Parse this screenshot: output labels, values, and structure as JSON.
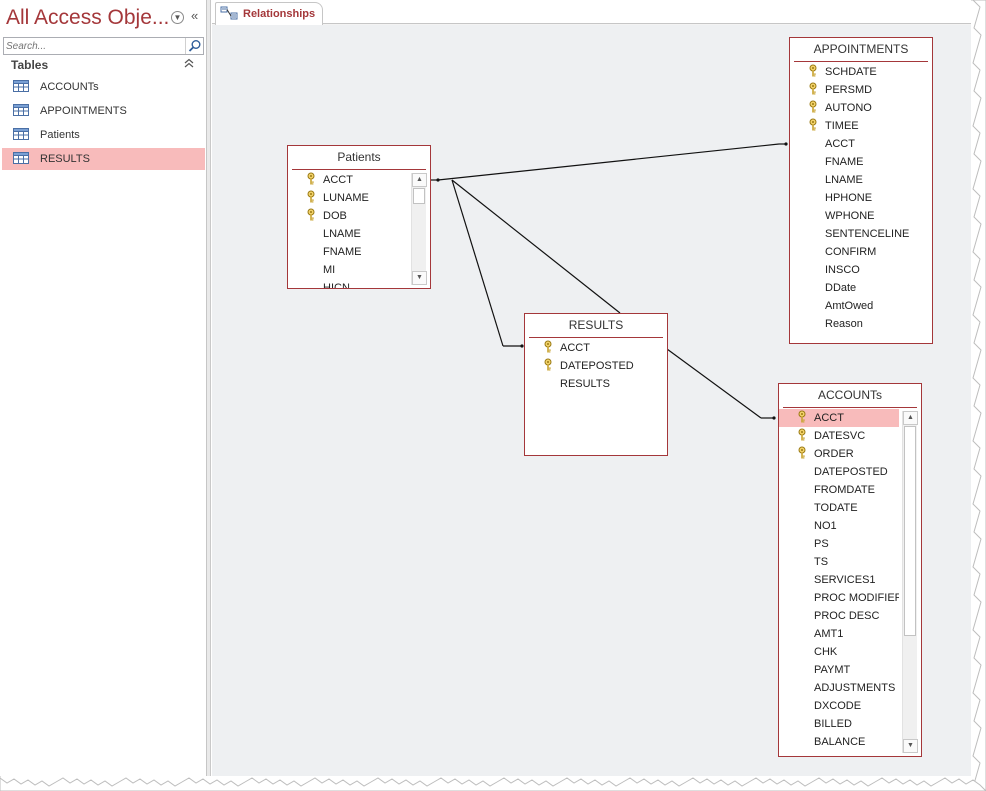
{
  "nav": {
    "title": "All Access Obje...",
    "search_placeholder": "Search...",
    "section_label": "Tables",
    "items": [
      {
        "label": "ACCOUNTs"
      },
      {
        "label": "APPOINTMENTS"
      },
      {
        "label": "Patients"
      },
      {
        "label": "RESULTS"
      }
    ],
    "selected_index": 3
  },
  "tab": {
    "label": "Relationships"
  },
  "tables": {
    "patients": {
      "title": "Patients",
      "fields": [
        "ACCT",
        "LUNAME",
        "DOB",
        "LNAME",
        "FNAME",
        "MI",
        "HICN"
      ],
      "key_count": 3
    },
    "appointments": {
      "title": "APPOINTMENTS",
      "fields": [
        "SCHDATE",
        "PERSMD",
        "AUTONO",
        "TIMEE",
        "ACCT",
        "FNAME",
        "LNAME",
        "HPHONE",
        "WPHONE",
        "SENTENCELINE",
        "CONFIRM",
        "INSCO",
        "DDate",
        "AmtOwed",
        "Reason"
      ],
      "key_count": 4
    },
    "results": {
      "title": "RESULTS",
      "fields": [
        "ACCT",
        "DATEPOSTED",
        "RESULTS"
      ],
      "key_count": 2
    },
    "accounts": {
      "title": "ACCOUNTs",
      "fields": [
        "ACCT",
        "DATESVC",
        "ORDER",
        "DATEPOSTED",
        "FROMDATE",
        "TODATE",
        "NO1",
        "PS",
        "TS",
        "SERVICES1",
        "PROC MODIFIER",
        "PROC DESC",
        "AMT1",
        "CHK",
        "PAYMT",
        "ADJUSTMENTS",
        "DXCODE",
        "BILLED",
        "BALANCE"
      ],
      "key_count": 3,
      "highlighted_field": "ACCT"
    }
  },
  "colors": {
    "accent": "#a4373a",
    "selection": "#f8bbbb",
    "canvas": "#eef0f2"
  }
}
